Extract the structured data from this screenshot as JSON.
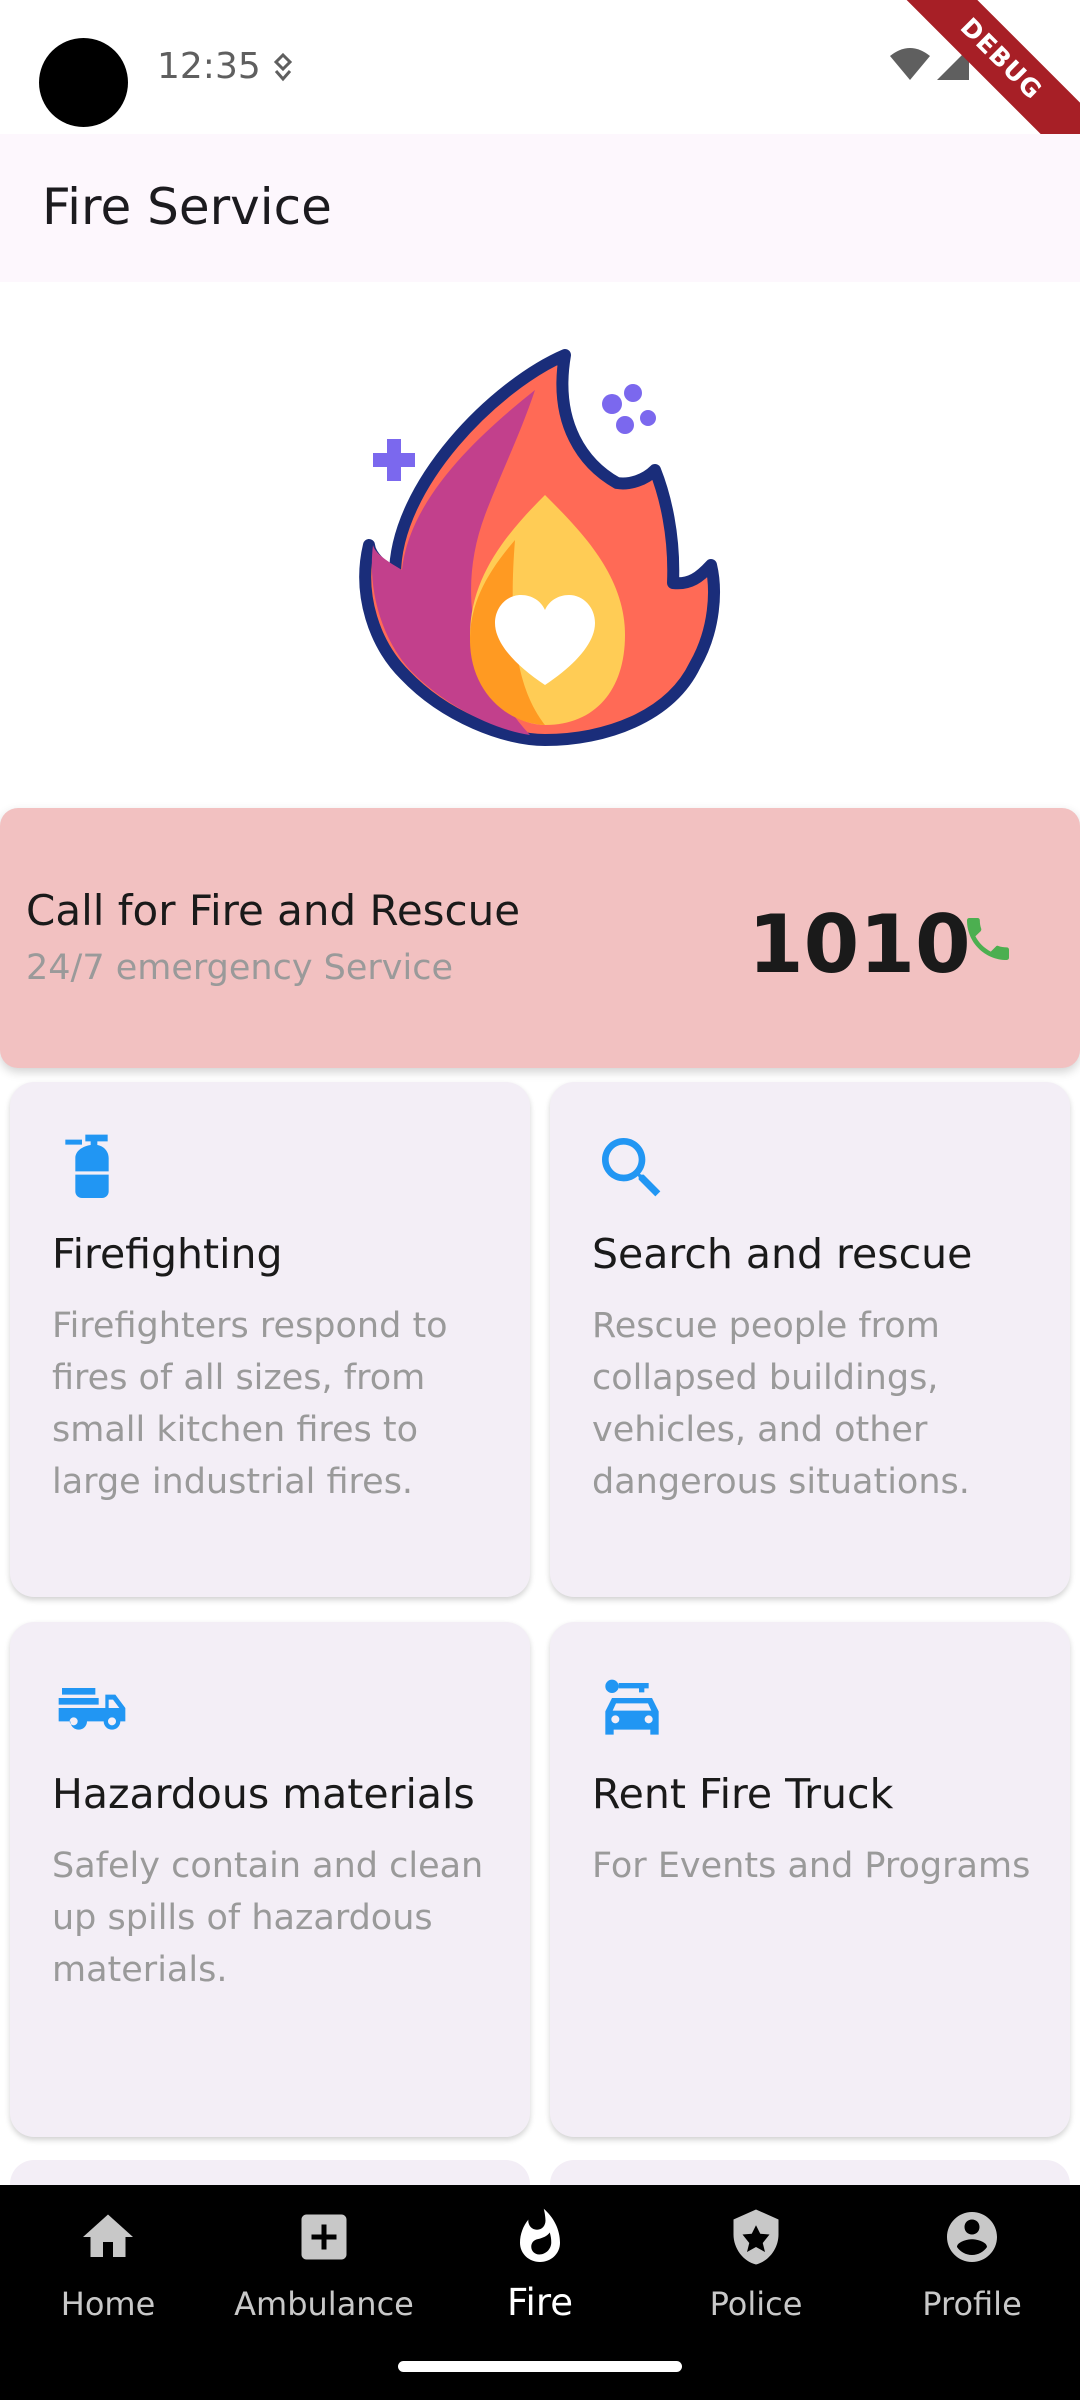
{
  "status_bar": {
    "time": "12:35",
    "debug_label": "DEBUG"
  },
  "app_bar": {
    "title": "Fire Service"
  },
  "hero": {
    "icon": "flame-heart-illustration"
  },
  "call_card": {
    "title": "Call for Fire and Rescue",
    "subtitle": "24/7 emergency Service",
    "number": "1010",
    "icon": "phone-icon"
  },
  "services": [
    {
      "icon": "fire-extinguisher-icon",
      "title": "Firefighting",
      "description": "Firefighters respond to fires of all sizes, from small kitchen fires to large industrial fires."
    },
    {
      "icon": "search-icon",
      "title": "Search and rescue",
      "description": "Rescue people from collapsed buildings, vehicles, and other dangerous situations."
    },
    {
      "icon": "fire-truck-icon",
      "title": "Hazardous materials",
      "description": "Safely contain and clean up spills of hazardous materials."
    },
    {
      "icon": "car-rental-icon",
      "title": "Rent Fire Truck",
      "description": "For Events and Programs"
    }
  ],
  "bottom_nav": {
    "items": [
      {
        "label": "Home",
        "icon": "home-icon"
      },
      {
        "label": "Ambulance",
        "icon": "medical-plus-icon"
      },
      {
        "label": "Fire",
        "icon": "fire-icon",
        "active": true
      },
      {
        "label": "Police",
        "icon": "shield-star-icon"
      },
      {
        "label": "Profile",
        "icon": "account-circle-icon"
      }
    ]
  },
  "colors": {
    "accent_blue": "#2196f3",
    "call_card_bg": "#f2c1c1",
    "phone_green": "#4caf50",
    "card_bg": "#f3eef6",
    "app_bar_bg": "#fdf7fd"
  }
}
